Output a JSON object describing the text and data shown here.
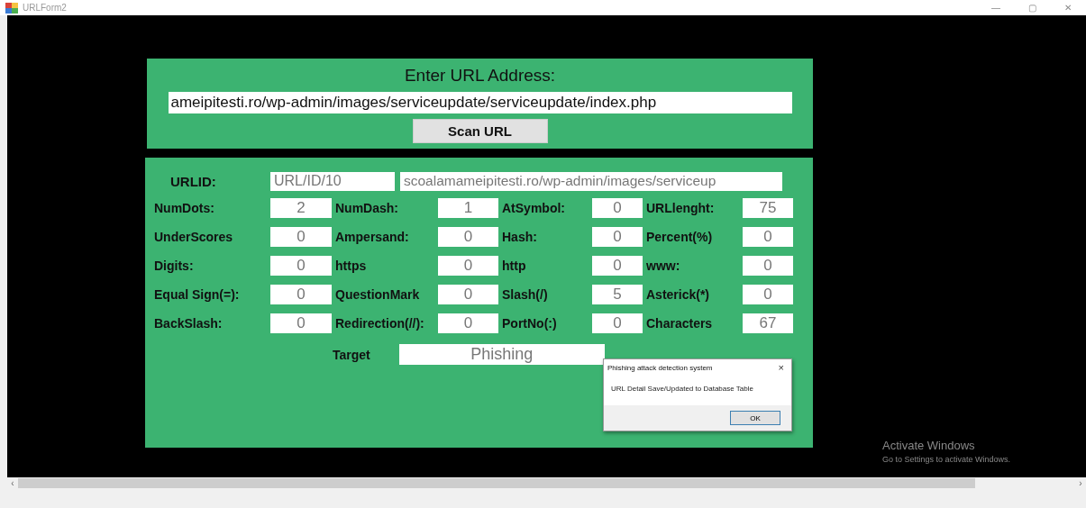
{
  "window": {
    "title": "URLForm2"
  },
  "entry": {
    "heading": "Enter URL Address:",
    "url": "ameipitesti.ro/wp-admin/images/serviceupdate/serviceupdate/index.php",
    "button": "Scan URL"
  },
  "details": {
    "urlid_label": "URLID:",
    "urlid": "URL/ID/10",
    "url": "scoalamameipitesti.ro/wp-admin/images/serviceup",
    "features": [
      {
        "label": "NumDots:",
        "value": "2"
      },
      {
        "label": "NumDash:",
        "value": "1"
      },
      {
        "label": "AtSymbol:",
        "value": "0"
      },
      {
        "label": "URLlenght:",
        "value": "75"
      },
      {
        "label": "UnderScores",
        "value": "0"
      },
      {
        "label": "Ampersand:",
        "value": "0"
      },
      {
        "label": "Hash:",
        "value": "0"
      },
      {
        "label": "Percent(%)",
        "value": "0"
      },
      {
        "label": "Digits:",
        "value": "0"
      },
      {
        "label": "https",
        "value": "0"
      },
      {
        "label": "http",
        "value": "0"
      },
      {
        "label": "www:",
        "value": "0"
      },
      {
        "label": "Equal Sign(=):",
        "value": "0"
      },
      {
        "label": "QuestionMark",
        "value": "0"
      },
      {
        "label": "Slash(/)",
        "value": "5"
      },
      {
        "label": "Asterick(*)",
        "value": "0"
      },
      {
        "label": "BackSlash:",
        "value": "0"
      },
      {
        "label": "Redirection(//):",
        "value": "0"
      },
      {
        "label": "PortNo(:)",
        "value": "0"
      },
      {
        "label": "Characters",
        "value": "67"
      }
    ],
    "target_label": "Target",
    "target": "Phishing"
  },
  "dialog": {
    "title": "Phishing attack detection system",
    "close": "×",
    "message": "URL Detail Save/Updated to Database Table",
    "button": "OK"
  },
  "activation": {
    "title": "Activate Windows",
    "subtitle": "Go to Settings to activate Windows."
  },
  "scrollbar": {
    "left": "‹",
    "right": "›"
  },
  "title_buttons": [
    "—",
    "▢",
    "✕"
  ]
}
